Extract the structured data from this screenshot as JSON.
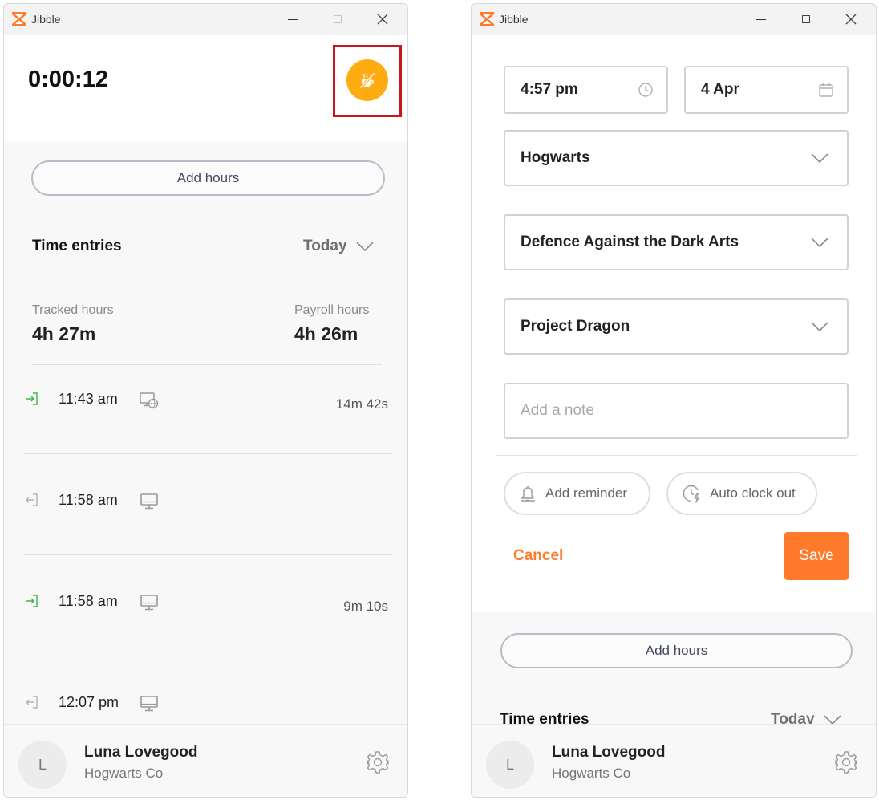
{
  "app": {
    "title": "Jibble"
  },
  "colors": {
    "brand": "#ff7a2a",
    "break_button": "#ffac13",
    "highlight": "#c8161d",
    "clock_in": "#3cb44b"
  },
  "left": {
    "timer": "0:00:12",
    "break_button_icon": "coffee-off-icon",
    "add_hours_label": "Add hours",
    "time_entries": {
      "title": "Time entries",
      "filter": "Today"
    },
    "stats": {
      "tracked_label": "Tracked hours",
      "tracked_value": "4h 27m",
      "payroll_label": "Payroll hours",
      "payroll_value": "4h 26m"
    },
    "entries": [
      {
        "type": "in",
        "time": "11:43 am",
        "device": "web-desktop-icon",
        "duration": "14m 42s"
      },
      {
        "type": "out",
        "time": "11:58 am",
        "device": "desktop-icon",
        "duration": ""
      },
      {
        "type": "in",
        "time": "11:58 am",
        "device": "desktop-icon",
        "duration": "9m 10s"
      },
      {
        "type": "out",
        "time": "12:07 pm",
        "device": "desktop-icon",
        "duration": ""
      }
    ]
  },
  "right": {
    "time_value": "4:57 pm",
    "date_value": "4 Apr",
    "organization": "Hogwarts",
    "activity": "Defence Against the Dark Arts",
    "project": "Project Dragon",
    "note_placeholder": "Add a note",
    "add_reminder_label": "Add reminder",
    "auto_clock_out_label": "Auto clock out",
    "cancel_label": "Cancel",
    "save_label": "Save",
    "add_hours_label": "Add hours",
    "time_entries": {
      "title": "Time entries",
      "filter": "Today"
    }
  },
  "user": {
    "initial": "L",
    "name": "Luna Lovegood",
    "org": "Hogwarts Co"
  }
}
